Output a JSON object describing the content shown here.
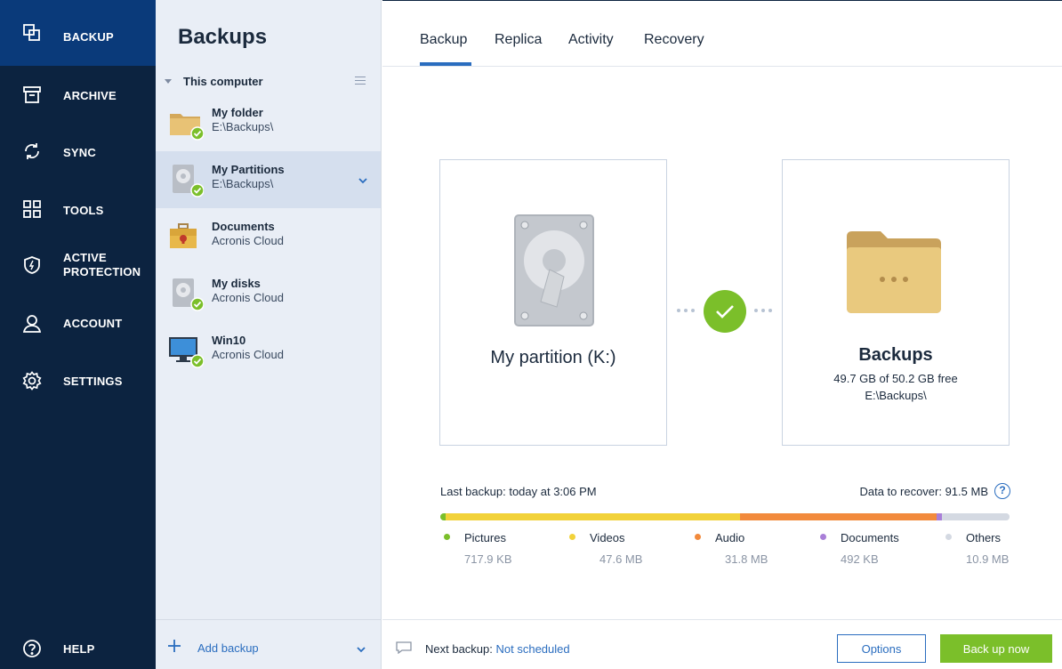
{
  "nav": {
    "items": [
      {
        "label": "BACKUP",
        "icon": "copy-icon"
      },
      {
        "label": "ARCHIVE",
        "icon": "archive-icon"
      },
      {
        "label": "SYNC",
        "icon": "sync-icon"
      },
      {
        "label": "TOOLS",
        "icon": "grid-icon"
      },
      {
        "label": "ACTIVE PROTECTION",
        "line1": "ACTIVE",
        "line2": "PROTECTION",
        "icon": "shield-icon"
      },
      {
        "label": "ACCOUNT",
        "icon": "user-icon"
      },
      {
        "label": "SETTINGS",
        "icon": "gear-icon"
      }
    ],
    "help": {
      "label": "HELP",
      "icon": "help-icon"
    }
  },
  "backups": {
    "title": "Backups",
    "group": "This computer",
    "items": [
      {
        "name": "My folder",
        "location": "E:\\Backups\\",
        "icon": "folder-icon",
        "status": "ok"
      },
      {
        "name": "My Partitions",
        "location": "E:\\Backups\\",
        "icon": "hard-drive-icon",
        "status": "ok",
        "selected": true
      },
      {
        "name": "Documents",
        "location": "Acronis Cloud",
        "icon": "briefcase-icon",
        "status": "none"
      },
      {
        "name": "My disks",
        "location": "Acronis Cloud",
        "icon": "hard-drive-icon",
        "status": "ok"
      },
      {
        "name": "Win10",
        "location": "Acronis Cloud",
        "icon": "monitor-icon",
        "status": "ok"
      }
    ],
    "add_label": "Add backup"
  },
  "tabs": [
    "Backup",
    "Replica",
    "Activity",
    "Recovery"
  ],
  "active_tab": "Backup",
  "source": {
    "title": "My partition (K:)"
  },
  "destination": {
    "title": "Backups",
    "free": "49.7 GB of 50.2 GB free",
    "path": "E:\\Backups\\"
  },
  "status": {
    "last_backup": "Last backup: today at 3:06 PM",
    "data_to_recover": "Data to recover: 91.5 MB",
    "help_glyph": "?"
  },
  "breakdown": [
    {
      "name": "Pictures",
      "value": "717.9 KB",
      "mb": 0.7179,
      "color": "#7bbf2a"
    },
    {
      "name": "Videos",
      "value": "47.6 MB",
      "mb": 47.6,
      "color": "#f2d23a"
    },
    {
      "name": "Audio",
      "value": "31.8 MB",
      "mb": 31.8,
      "color": "#f28a3c"
    },
    {
      "name": "Documents",
      "value": "492 KB",
      "mb": 0.492,
      "color": "#a97fd8"
    },
    {
      "name": "Others",
      "value": "10.9 MB",
      "mb": 10.9,
      "color": "#d4d9e2"
    }
  ],
  "footer": {
    "next_backup_label": "Next backup:",
    "next_backup_value": "Not scheduled",
    "options_label": "Options",
    "backup_now_label": "Back up now"
  },
  "colors": {
    "nav_bg": "#0c2340",
    "nav_active": "#0a3a7a",
    "accent": "#2a6dbf",
    "success": "#7bbf2a"
  }
}
